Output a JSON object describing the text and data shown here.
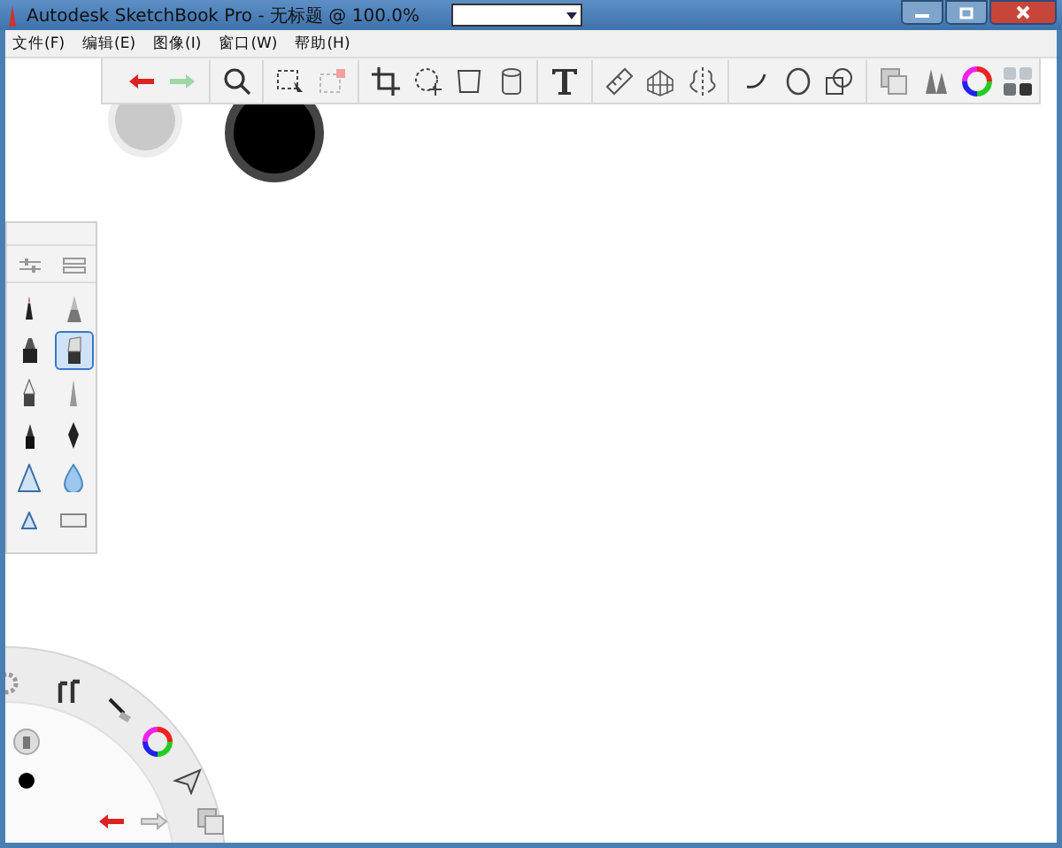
{
  "window": {
    "title": "Autodesk SketchBook Pro - 无标题 @ 100.0%"
  },
  "menu": [
    "文件(F)",
    "编辑(E)",
    "图像(I)",
    "窗口(W)",
    "帮助(H)"
  ],
  "brushes": [
    {
      "kind": "pencil",
      "selected": false
    },
    {
      "kind": "inkpen",
      "selected": false
    },
    {
      "kind": "marker",
      "selected": false
    },
    {
      "kind": "chisel",
      "selected": true
    },
    {
      "kind": "felt",
      "selected": false
    },
    {
      "kind": "airbrush",
      "selected": false
    },
    {
      "kind": "pen",
      "selected": false
    },
    {
      "kind": "nib",
      "selected": false
    },
    {
      "kind": "triangle",
      "selected": false
    },
    {
      "kind": "drop",
      "selected": false
    },
    {
      "kind": "smalltriangle",
      "selected": false
    },
    {
      "kind": "eraser",
      "selected": false
    }
  ]
}
